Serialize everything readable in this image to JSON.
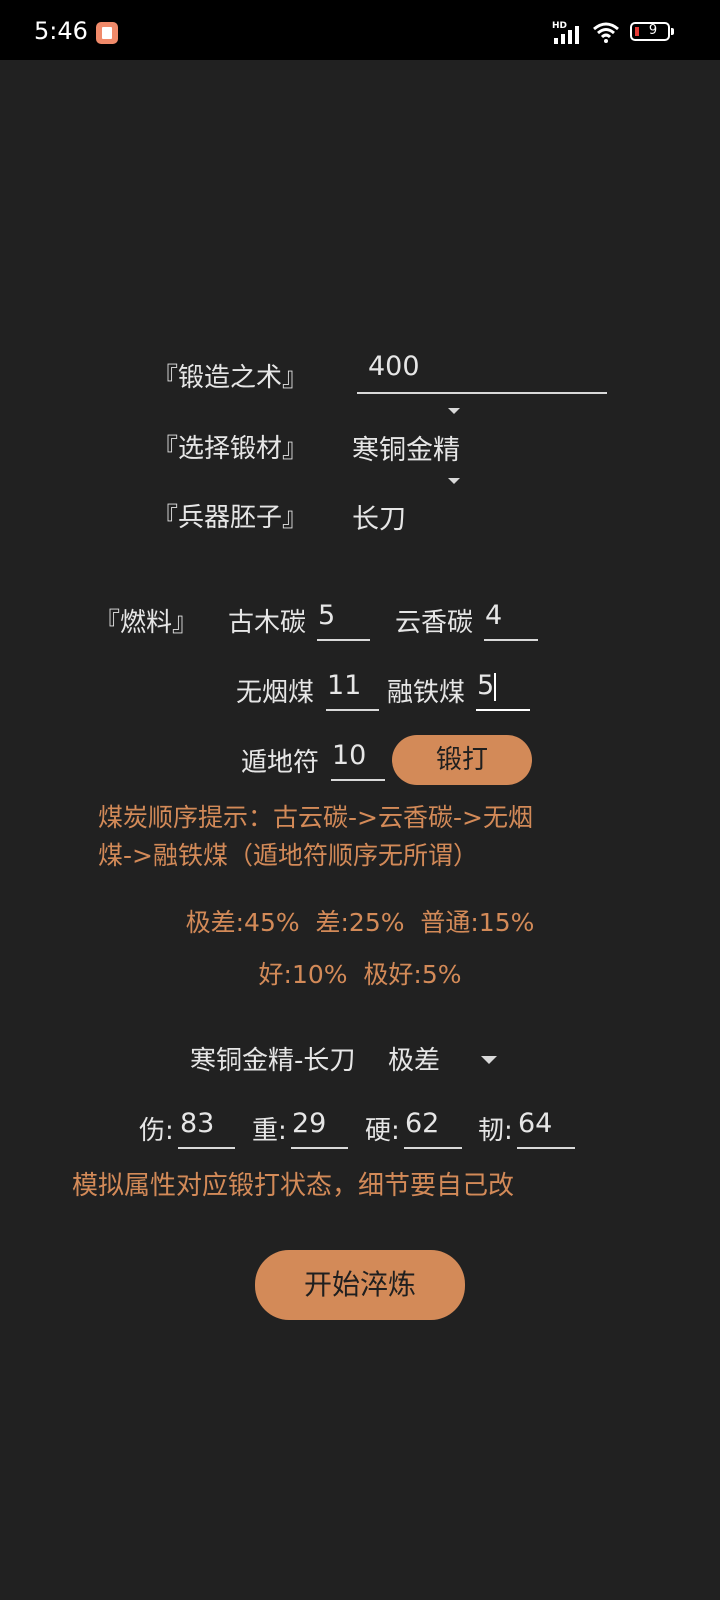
{
  "status_bar": {
    "time": "5:46",
    "network": "HD",
    "battery": "9"
  },
  "form": {
    "forging_skill": {
      "label": "『锻造之术』",
      "value": "400"
    },
    "material": {
      "label": "『选择锻材』",
      "value": "寒铜金精"
    },
    "weapon_blank": {
      "label": "『兵器胚子』",
      "value": "长刀"
    }
  },
  "fuel": {
    "label": "『燃料』",
    "gumutan": {
      "label": "古木碳",
      "value": "5"
    },
    "yunxiangtan": {
      "label": "云香碳",
      "value": "4"
    },
    "wuyanmei": {
      "label": "无烟煤",
      "value": "11"
    },
    "rongtiemei": {
      "label": "融铁煤",
      "value": "5"
    },
    "dundifu": {
      "label": "遁地符",
      "value": "10"
    },
    "forge_button": "锻打"
  },
  "hint": {
    "line1": "煤炭顺序提示：古云碳->云香碳->无烟",
    "line2": "煤->融铁煤（遁地符顺序无所谓）"
  },
  "odds": {
    "line1": "极差:45%  差:25%  普通:15%",
    "line2": "好:10%  极好:5%"
  },
  "result": {
    "item": "寒铜金精-长刀",
    "quality": "极差"
  },
  "stats": {
    "damage": {
      "label": "伤:",
      "value": "83"
    },
    "weight": {
      "label": "重:",
      "value": "29"
    },
    "hardness": {
      "label": "硬:",
      "value": "62"
    },
    "toughness": {
      "label": "韧:",
      "value": "64"
    }
  },
  "note": "模拟属性对应锻打状态，细节要自己改",
  "start_button": "开始淬炼",
  "colors": {
    "background": "#212121",
    "accent": "#d38a58",
    "status_bar": "#000000"
  }
}
